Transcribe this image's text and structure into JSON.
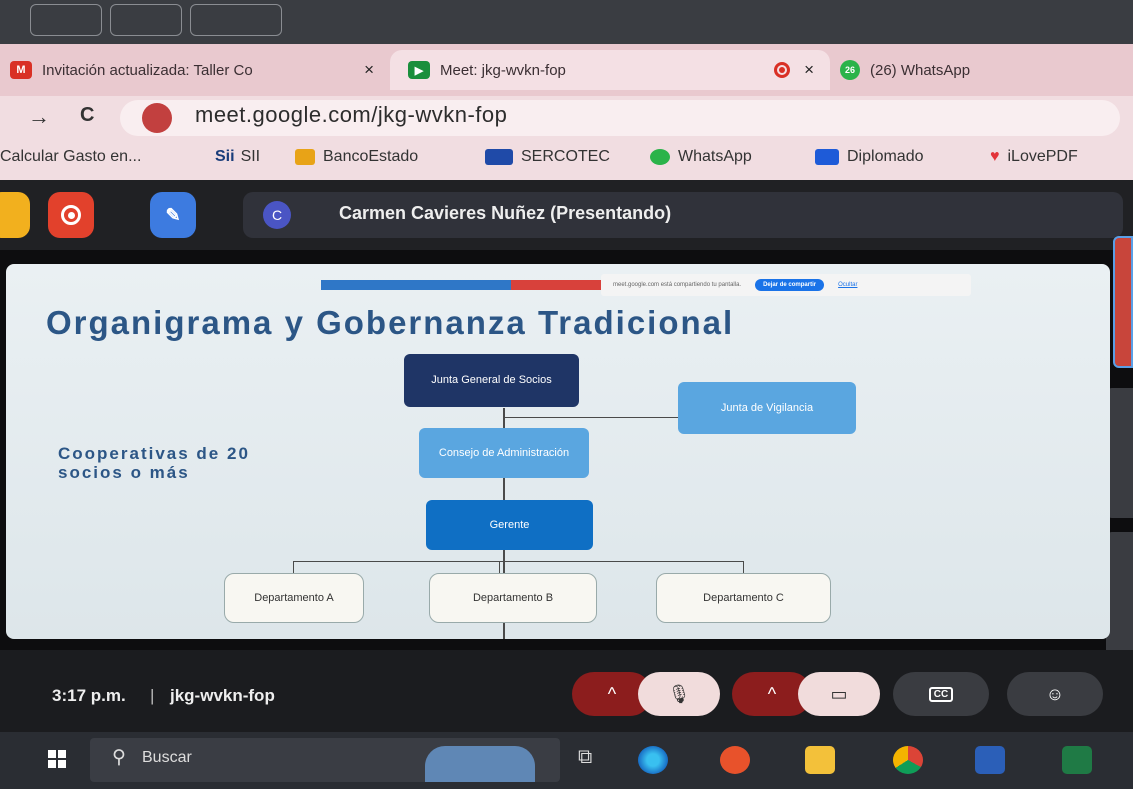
{
  "browser": {
    "tabs": [
      {
        "label": "Invitación actualizada: Taller Co",
        "icon": "gmail-icon"
      },
      {
        "label": "Meet: jkg-wvkn-fop",
        "icon": "meet-icon"
      },
      {
        "label": "(26) WhatsApp",
        "icon": "whatsapp-icon",
        "badge": "26"
      }
    ],
    "close_glyph": "×",
    "url": "meet.google.com/jkg-wvkn-fop",
    "nav": {
      "back": "→",
      "reload": "C"
    },
    "bookmarks": [
      {
        "label": "Calcular Gasto en...",
        "color": "#9aa"
      },
      {
        "label": "SII",
        "prefix": "Sii",
        "color": "#1a3d7a"
      },
      {
        "label": "BancoEstado",
        "color": "#e8a317"
      },
      {
        "label": "SERCOTEC",
        "color": "#1f4aa8"
      },
      {
        "label": "WhatsApp",
        "color": "#2bb34a"
      },
      {
        "label": "Diplomado",
        "color": "#1e5bd8"
      },
      {
        "label": "iLovePDF",
        "color": "#e3343a"
      }
    ]
  },
  "meet": {
    "presenter_initial": "C",
    "presenter_label": "Carmen Cavieres Nuñez (Presentando)",
    "time": "3:17 p.m.",
    "separator": "|",
    "meeting_code": "jkg-wvkn-fop"
  },
  "share_notice": {
    "text": "meet.google.com está compartiendo tu pantalla.",
    "stop_button": "Dejar de compartir",
    "hide_link": "Ocultar"
  },
  "slide": {
    "title": "Organigrama y Gobernanza Tradicional",
    "subtitle_line1": "Cooperativas de 20",
    "subtitle_line2": "socios o más",
    "boxes": {
      "junta_general": "Junta General de Socios",
      "junta_vigilancia": "Junta de Vigilancia",
      "consejo": "Consejo de Administración",
      "gerente": "Gerente",
      "depto_a": "Departamento A",
      "depto_b": "Departamento B",
      "depto_c": "Departamento C"
    }
  },
  "taskbar": {
    "search_placeholder": "Buscar"
  },
  "colors": {
    "navy": "#1f3566",
    "light_blue": "#5aa6e0",
    "blue": "#0f6fc4",
    "tab_bar": "#e9c9cf",
    "meet_dark": "#202124"
  }
}
